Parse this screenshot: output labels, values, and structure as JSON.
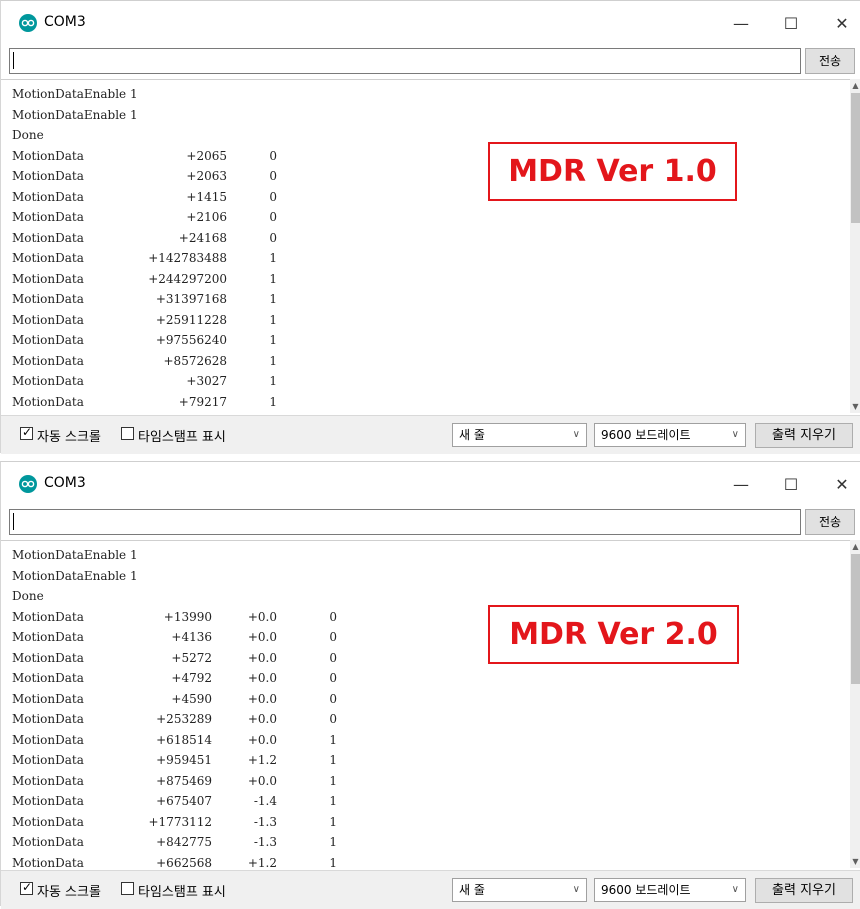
{
  "windows": [
    {
      "title": "COM3",
      "send_label": "전송",
      "badge": "MDR Ver 1.0",
      "lines": [
        {
          "c": [
            "MotionDataEnable 1"
          ]
        },
        {
          "c": [
            "MotionDataEnable 1"
          ]
        },
        {
          "c": [
            "Done"
          ]
        },
        {
          "c": [
            "MotionData",
            "+2065",
            "0"
          ]
        },
        {
          "c": [
            "MotionData",
            "+2063",
            "0"
          ]
        },
        {
          "c": [
            "MotionData",
            "+1415",
            "0"
          ]
        },
        {
          "c": [
            "MotionData",
            "+2106",
            "0"
          ]
        },
        {
          "c": [
            "MotionData",
            "+24168",
            "0"
          ]
        },
        {
          "c": [
            "MotionData",
            "+142783488",
            "1"
          ]
        },
        {
          "c": [
            "MotionData",
            "+244297200",
            "1"
          ]
        },
        {
          "c": [
            "MotionData",
            "+31397168",
            "1"
          ]
        },
        {
          "c": [
            "MotionData",
            "+25911228",
            "1"
          ]
        },
        {
          "c": [
            "MotionData",
            "+97556240",
            "1"
          ]
        },
        {
          "c": [
            "MotionData",
            "+8572628",
            "1"
          ]
        },
        {
          "c": [
            "MotionData",
            "+3027",
            "1"
          ]
        },
        {
          "c": [
            "MotionData",
            "+79217",
            "1"
          ]
        }
      ],
      "autoscroll_label": "자동 스크롤",
      "autoscroll_checked": true,
      "timestamp_label": "타임스탬프 표시",
      "timestamp_checked": false,
      "line_ending": "새 줄",
      "baud": "9600 보드레이트",
      "clear_label": "출력 지우기"
    },
    {
      "title": "COM3",
      "send_label": "전송",
      "badge": "MDR Ver 2.0",
      "lines": [
        {
          "c": [
            "MotionDataEnable 1"
          ]
        },
        {
          "c": [
            "MotionDataEnable 1"
          ]
        },
        {
          "c": [
            "Done"
          ]
        },
        {
          "c": [
            "MotionData",
            "+13990",
            "+0.0",
            "0"
          ]
        },
        {
          "c": [
            "MotionData",
            "+4136",
            "+0.0",
            "0"
          ]
        },
        {
          "c": [
            "MotionData",
            "+5272",
            "+0.0",
            "0"
          ]
        },
        {
          "c": [
            "MotionData",
            "+4792",
            "+0.0",
            "0"
          ]
        },
        {
          "c": [
            "MotionData",
            "+4590",
            "+0.0",
            "0"
          ]
        },
        {
          "c": [
            "MotionData",
            "+253289",
            "+0.0",
            "0"
          ]
        },
        {
          "c": [
            "MotionData",
            "+618514",
            "+0.0",
            "1"
          ]
        },
        {
          "c": [
            "MotionData",
            "+959451",
            "+1.2",
            "1"
          ]
        },
        {
          "c": [
            "MotionData",
            "+875469",
            "+0.0",
            "1"
          ]
        },
        {
          "c": [
            "MotionData",
            "+675407",
            "-1.4",
            "1"
          ]
        },
        {
          "c": [
            "MotionData",
            "+1773112",
            "-1.3",
            "1"
          ]
        },
        {
          "c": [
            "MotionData",
            "+842775",
            "-1.3",
            "1"
          ]
        },
        {
          "c": [
            "MotionData",
            "+662568",
            "+1.2",
            "1"
          ]
        }
      ],
      "autoscroll_label": "자동 스크롤",
      "autoscroll_checked": true,
      "timestamp_label": "타임스탬프 표시",
      "timestamp_checked": false,
      "line_ending": "새 줄",
      "baud": "9600 보드레이트",
      "clear_label": "출력 지우기"
    }
  ],
  "icons": {
    "minimize": "minimize-icon",
    "maximize": "maximize-icon",
    "close": "close-icon",
    "app": "arduino-icon"
  }
}
